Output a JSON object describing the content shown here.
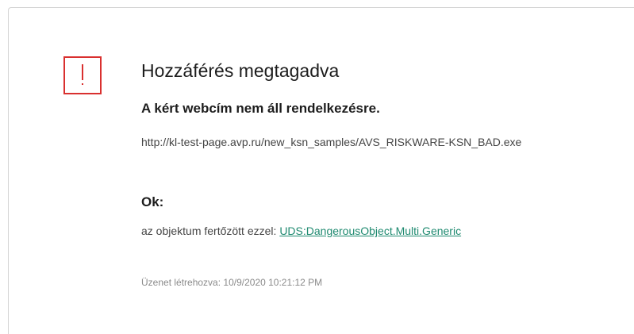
{
  "alert": {
    "icon": "warning-exclamation-icon",
    "accent_color": "#d9302f",
    "title": "Hozzáférés megtagadva",
    "subtitle": "A kért webcím nem áll rendelkezésre.",
    "url": "http://kl-test-page.avp.ru/new_ksn_samples/AVS_RISKWARE-KSN_BAD.exe",
    "reason_heading": "Ok:",
    "reason_prefix": "az objektum fertőzött ezzel:",
    "threat_name": "UDS:DangerousObject.Multi.Generic",
    "link_color": "#1f8a70",
    "created_label": "Üzenet létrehozva:",
    "created_value": "10/9/2020 10:21:12 PM"
  }
}
